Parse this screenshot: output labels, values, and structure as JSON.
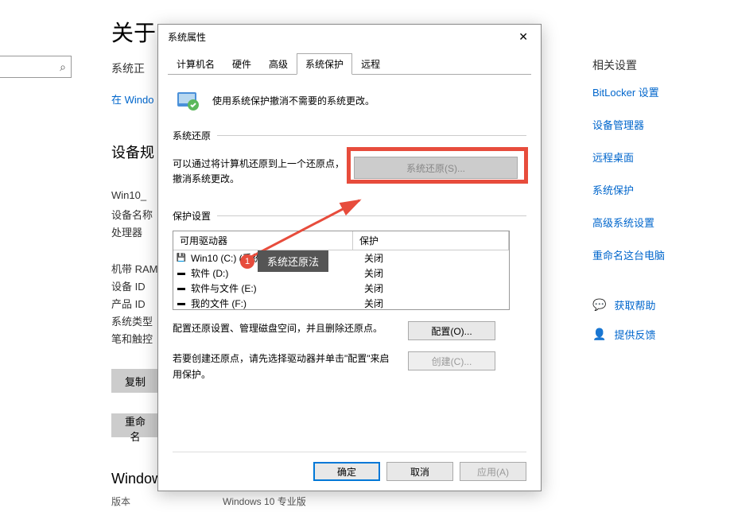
{
  "page": {
    "title": "关于",
    "subtitle": "系统正",
    "windows_link": "在 Windo",
    "device_specs_heading": "设备规",
    "windows_specs_heading": "Windows",
    "edition_label": "版本",
    "edition_value": "Windows 10 专业版",
    "copy_btn": "复制",
    "rename_btn": "重命名",
    "specs": [
      "Win10_",
      "设备名称",
      "处理器",
      "机带 RAM",
      "设备 ID",
      "产品 ID",
      "系统类型",
      "笔和触控"
    ]
  },
  "right": {
    "heading": "相关设置",
    "links": [
      "BitLocker 设置",
      "设备管理器",
      "远程桌面",
      "系统保护",
      "高级系统设置",
      "重命名这台电脑"
    ],
    "help": "获取帮助",
    "feedback": "提供反馈"
  },
  "dialog": {
    "title": "系统属性",
    "tabs": [
      "计算机名",
      "硬件",
      "高级",
      "系统保护",
      "远程"
    ],
    "active_tab": 3,
    "intro": "使用系统保护撤消不需要的系统更改。",
    "restore": {
      "group_title": "系统还原",
      "desc": "可以通过将计算机还原到上一个还原点，撤消系统更改。",
      "button": "系统还原(S)..."
    },
    "settings": {
      "group_title": "保护设置",
      "headers": [
        "可用驱动器",
        "保护"
      ],
      "drives": [
        {
          "name": "Win10 (C:) (系统)",
          "protection": "关闭",
          "icon": "hd"
        },
        {
          "name": "软件 (D:)",
          "protection": "关闭",
          "icon": "hd2"
        },
        {
          "name": "软件与文件 (E:)",
          "protection": "关闭",
          "icon": "hd2"
        },
        {
          "name": "我的文件 (F:)",
          "protection": "关闭",
          "icon": "hd2"
        }
      ],
      "configure_desc": "配置还原设置、管理磁盘空间，并且删除还原点。",
      "configure_btn": "配置(O)...",
      "create_desc": "若要创建还原点，请先选择驱动器并单击\"配置\"来启用保护。",
      "create_btn": "创建(C)..."
    },
    "buttons": {
      "ok": "确定",
      "cancel": "取消",
      "apply": "应用(A)"
    }
  },
  "callout": {
    "num": "1",
    "label": "系统还原法"
  }
}
